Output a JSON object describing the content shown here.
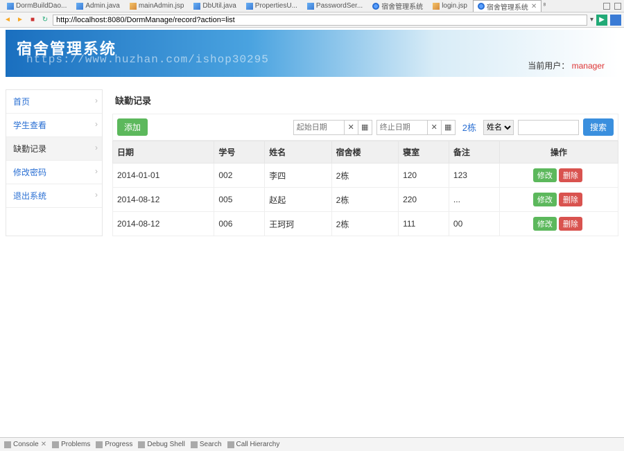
{
  "ide": {
    "tabs": [
      {
        "label": "DormBuildDao...",
        "icon": "ico-j"
      },
      {
        "label": "Admin.java",
        "icon": "ico-j"
      },
      {
        "label": "mainAdmin.jsp",
        "icon": "ico-jsp"
      },
      {
        "label": "DbUtil.java",
        "icon": "ico-j"
      },
      {
        "label": "PropertiesU...",
        "icon": "ico-j"
      },
      {
        "label": "PasswordSer...",
        "icon": "ico-j"
      },
      {
        "label": "宿舍管理系统",
        "icon": "ico-web"
      },
      {
        "label": "login.jsp",
        "icon": "ico-jsp"
      },
      {
        "label": "宿舍管理系统",
        "icon": "ico-web",
        "active": true
      }
    ],
    "suffix": "⁸"
  },
  "browser": {
    "url": "http://localhost:8080/DormManage/record?action=list"
  },
  "banner": {
    "title": "宿舍管理系统",
    "watermark": "https://www.huzhan.com/ishop30295",
    "user_label": "当前用户：",
    "user_name": "manager"
  },
  "sidebar": {
    "items": [
      {
        "label": "首页"
      },
      {
        "label": "学生查看"
      },
      {
        "label": "缺勤记录",
        "active": true
      },
      {
        "label": "修改密码"
      },
      {
        "label": "退出系统"
      }
    ]
  },
  "crumb": "缺勤记录",
  "toolbar": {
    "add": "添加",
    "start_placeholder": "起始日期",
    "end_placeholder": "终止日期",
    "clear_sym": "✕",
    "cal_sym": "▦",
    "building": "2栋",
    "select_value": "姓名",
    "search_btn": "搜索"
  },
  "table": {
    "headers": [
      "日期",
      "学号",
      "姓名",
      "宿舍楼",
      "寝室",
      "备注",
      "操作"
    ],
    "rows": [
      {
        "date": "2014-01-01",
        "sno": "002",
        "name": "李四",
        "build": "2栋",
        "room": "120",
        "remark": "123"
      },
      {
        "date": "2014-08-12",
        "sno": "005",
        "name": "赵起",
        "build": "2栋",
        "room": "220",
        "remark": "..."
      },
      {
        "date": "2014-08-12",
        "sno": "006",
        "name": "王珂珂",
        "build": "2栋",
        "room": "111",
        "remark": "00"
      }
    ],
    "edit": "修改",
    "del": "删除"
  },
  "status": {
    "panes": [
      "Console",
      "Problems",
      "Progress",
      "Debug Shell",
      "Search",
      "Call Hierarchy"
    ]
  }
}
